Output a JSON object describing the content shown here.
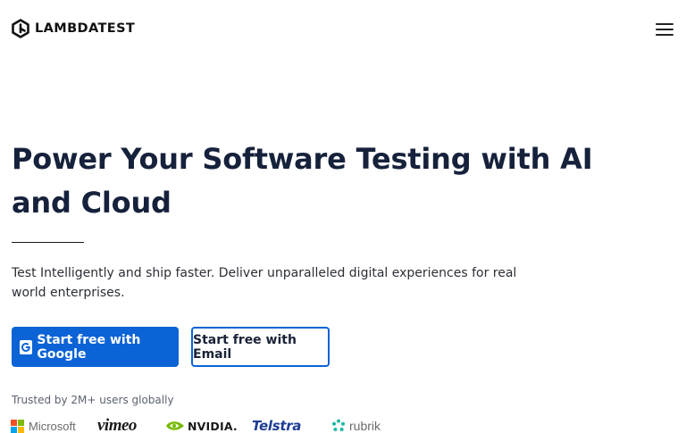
{
  "header": {
    "brand_name": "LAMBDATEST",
    "menu_icon": "hamburger-menu-icon"
  },
  "hero": {
    "headline": "Power Your Software Testing with AI and Cloud",
    "subtitle": "Test Intelligently and ship faster. Deliver unparalleled digital experiences for real world enterprises."
  },
  "cta": {
    "google_label": "Start free with Google",
    "email_label": "Start free with Email"
  },
  "trust": {
    "trusted_text": "Trusted by 2M+ users globally",
    "logos": [
      {
        "name": "Microsoft"
      },
      {
        "name": "vimeo"
      },
      {
        "name": "NVIDIA."
      },
      {
        "name": "Telstra"
      },
      {
        "name": "rubrik"
      }
    ]
  },
  "colors": {
    "primary": "#0b63d6",
    "heading": "#16213b",
    "text": "#2b2f36",
    "muted": "#5b6270"
  }
}
